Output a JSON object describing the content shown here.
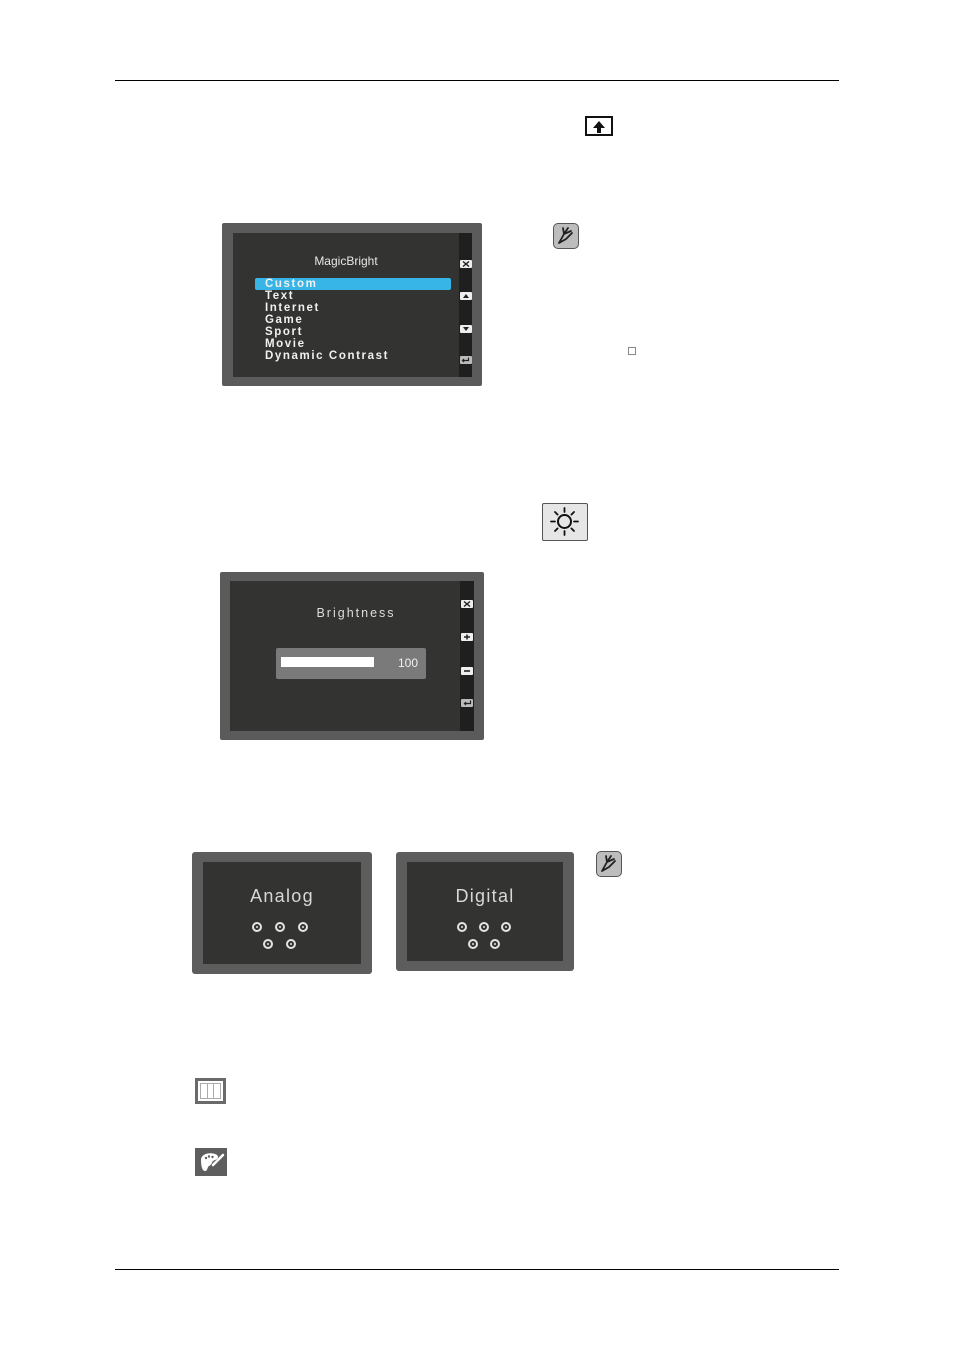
{
  "page": {
    "rules": [
      "top",
      "bottom"
    ]
  },
  "icons": {
    "menu_up": "menu-up-arrow-icon",
    "note": "note-pencil-icon",
    "brightness": "sun-icon",
    "position": "columns-icon",
    "color": "palette-icon"
  },
  "magicbright_osd": {
    "title": "MagicBright",
    "items": [
      {
        "label": "Custom",
        "selected": true
      },
      {
        "label": "Text",
        "selected": false
      },
      {
        "label": "Internet",
        "selected": false
      },
      {
        "label": "Game",
        "selected": false
      },
      {
        "label": "Sport",
        "selected": false
      },
      {
        "label": "Movie",
        "selected": false
      },
      {
        "label": "Dynamic Contrast",
        "selected": false
      }
    ],
    "side_buttons": [
      "close",
      "up",
      "down",
      "enter"
    ],
    "highlight_color": "#37b5e6"
  },
  "brightness_osd": {
    "title": "Brightness",
    "value": "100",
    "level_percent": 100,
    "side_buttons": [
      "close",
      "plus",
      "minus",
      "enter"
    ]
  },
  "source_screens": [
    {
      "label": "Analog"
    },
    {
      "label": "Digital"
    }
  ]
}
